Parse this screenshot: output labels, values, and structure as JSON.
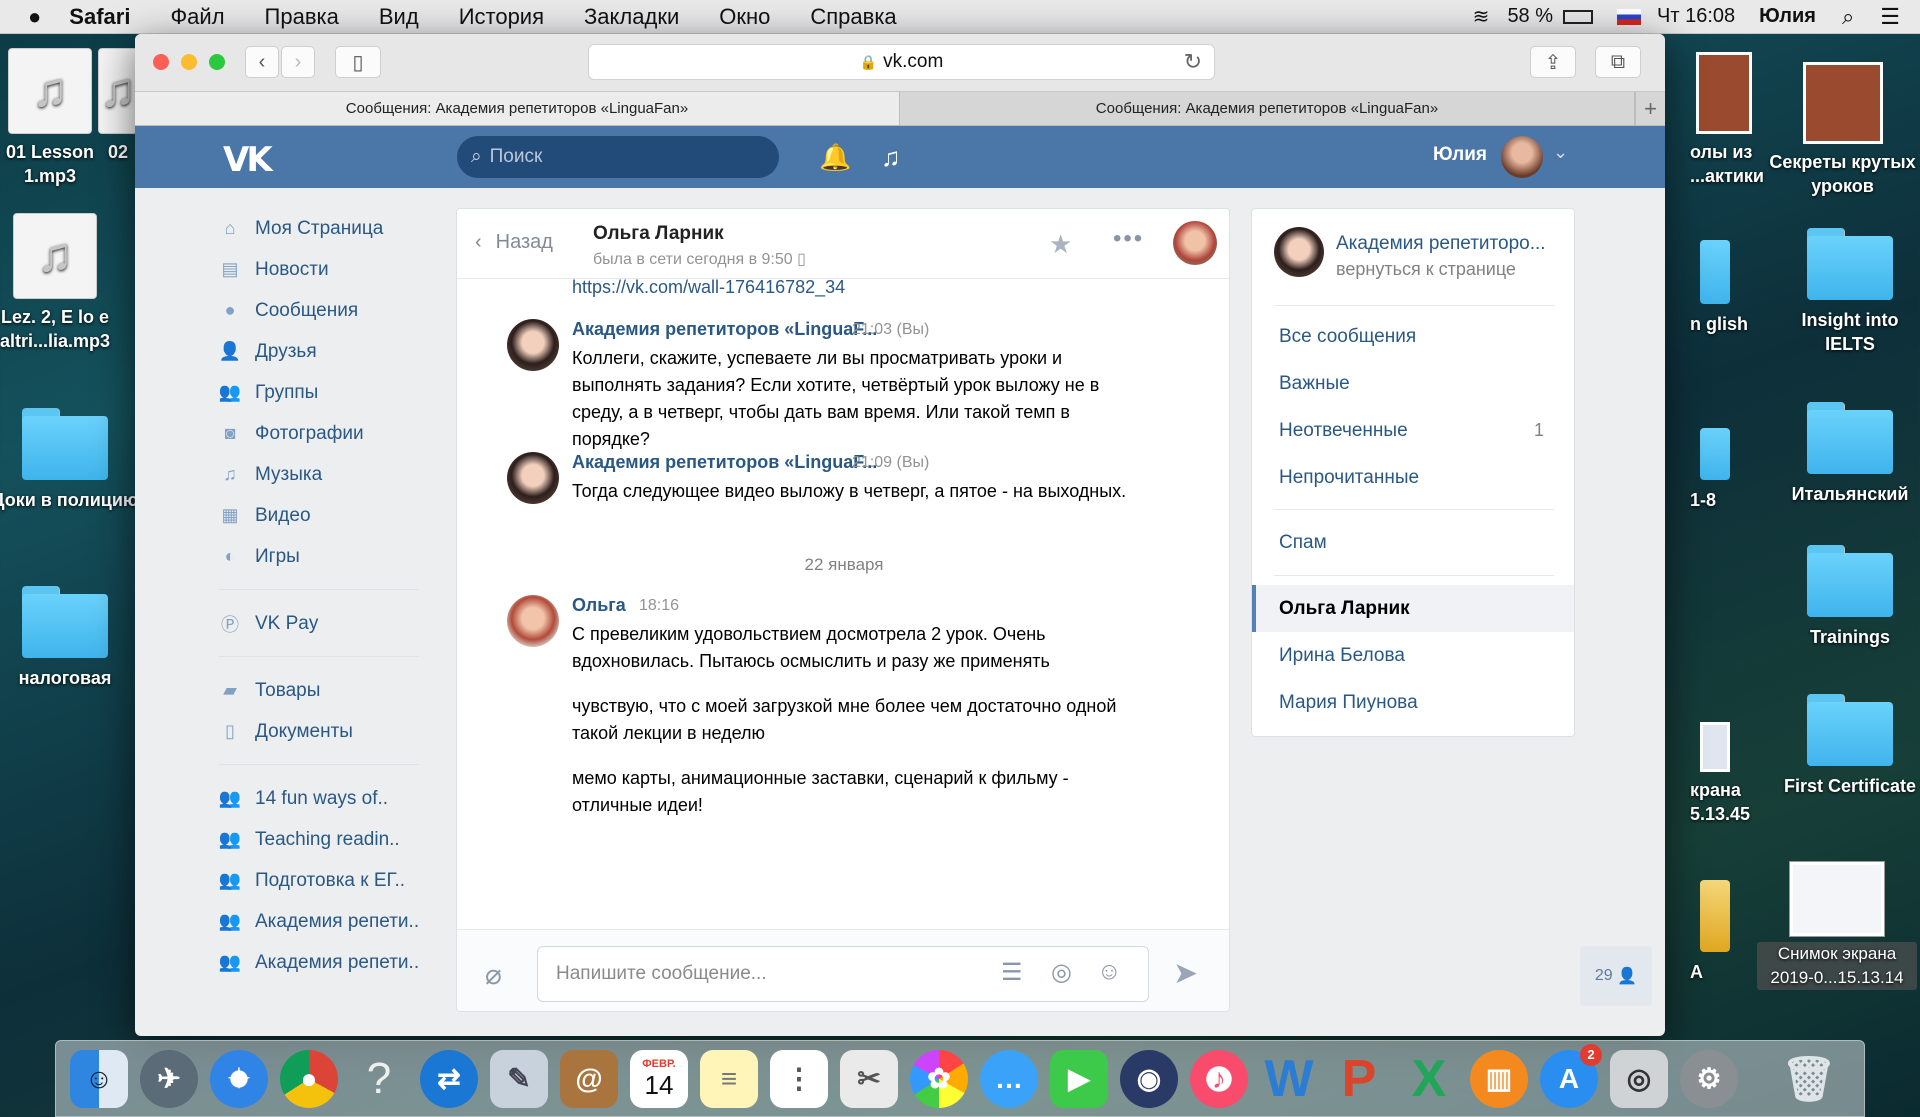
{
  "menubar": {
    "apple": "",
    "app": "Safari",
    "items": [
      "Файл",
      "Правка",
      "Вид",
      "История",
      "Закладки",
      "Окно",
      "Справка"
    ],
    "battery": "58 %",
    "clock": "Чт 16:08",
    "user": "Юлия"
  },
  "desktop": {
    "left": [
      {
        "label": "01 Lesson 1.mp3",
        "kind": "music"
      },
      {
        "label": "02",
        "kind": "music"
      },
      {
        "label": "Lez. 2, E lo e altri...lia.mp3",
        "kind": "music"
      },
      {
        "label": "Доки в полицию",
        "kind": "folder"
      },
      {
        "label": "налоговая",
        "kind": "folder"
      }
    ],
    "right": [
      {
        "label": "олы из ...актики",
        "kind": "thumb"
      },
      {
        "label": "Секреты крутых уроков",
        "kind": "thumb"
      },
      {
        "label": "n glish",
        "kind": "folder"
      },
      {
        "label": "Insight into IELTS",
        "kind": "folder"
      },
      {
        "label": "1-8",
        "kind": "folder"
      },
      {
        "label": "Итальянский",
        "kind": "folder"
      },
      {
        "label": "Trainings",
        "kind": "folder"
      },
      {
        "label": "крана 5.13.45",
        "kind": "thumb"
      },
      {
        "label": "First Certificate",
        "kind": "folder"
      },
      {
        "label": "A",
        "kind": "folder"
      },
      {
        "label": "Снимок экрана 2019-0...15.13.14",
        "kind": "thumb"
      }
    ]
  },
  "browser": {
    "url": "vk.com",
    "tabs": [
      "Сообщения: Академия репетиторов «LinguaFan»",
      "Сообщения: Академия репетиторов «LinguaFan»"
    ]
  },
  "vk": {
    "logo": "VK",
    "search_placeholder": "Поиск",
    "user_name": "Юлия",
    "nav": [
      {
        "label": "Моя Страница",
        "icon": "home-icon",
        "glyph": "⌂"
      },
      {
        "label": "Новости",
        "icon": "news-icon",
        "glyph": "▤"
      },
      {
        "label": "Сообщения",
        "icon": "messages-icon",
        "glyph": "●"
      },
      {
        "label": "Друзья",
        "icon": "friends-icon",
        "glyph": "👤"
      },
      {
        "label": "Группы",
        "icon": "groups-icon",
        "glyph": "👥"
      },
      {
        "label": "Фотографии",
        "icon": "photo-icon",
        "glyph": "◙"
      },
      {
        "label": "Музыка",
        "icon": "music-icon",
        "glyph": "♫"
      },
      {
        "label": "Видео",
        "icon": "video-icon",
        "glyph": "▦"
      },
      {
        "label": "Игры",
        "icon": "games-icon",
        "glyph": "◐"
      }
    ],
    "nav2": [
      {
        "label": "VK Pay",
        "icon": "vkpay-icon",
        "glyph": "Ⓟ"
      }
    ],
    "nav3": [
      {
        "label": "Товары",
        "icon": "goods-icon",
        "glyph": "▰"
      },
      {
        "label": "Документы",
        "icon": "documents-icon",
        "glyph": "▯"
      }
    ],
    "nav4": [
      {
        "label": "14 fun ways of..",
        "icon": "group-icon",
        "glyph": "👥"
      },
      {
        "label": "Teaching readin..",
        "icon": "group-icon",
        "glyph": "👥"
      },
      {
        "label": "Подготовка к ЕГ..",
        "icon": "group-icon",
        "glyph": "👥"
      },
      {
        "label": "Академия репети..",
        "icon": "group-icon",
        "glyph": "👥"
      },
      {
        "label": "Академия репети..",
        "icon": "group-icon",
        "glyph": "👥"
      }
    ]
  },
  "chat": {
    "back_label": "Назад",
    "name": "Ольга Ларник",
    "status": "была в сети сегодня в 9:50",
    "top_link": "https://vk.com/wall-176416782_34",
    "messages": [
      {
        "author": "Академия репетиторов «LinguaF...",
        "time": "21:03 (Вы)",
        "paragraphs": [
          "Коллеги, скажите, успеваете ли вы просматривать уроки и выполнять задания? Если хотите, четвёртый урок выложу не в среду, а в четверг, чтобы дать вам время. Или такой темп в порядке?"
        ]
      },
      {
        "author": "Академия репетиторов «LinguaF...",
        "time": "21:09 (Вы)",
        "paragraphs": [
          "Тогда следующее видео выложу в четверг, а пятое - на выходных."
        ]
      },
      {
        "author": "Ольга",
        "time": "18:16",
        "paragraphs": [
          "С превеликим удовольствием досмотрела 2 урок. Очень вдохновилась. Пытаюсь осмыслить и разу же применять",
          "чувствую, что с моей загрузкой мне более чем достаточно одной такой лекции в неделю",
          "мемо карты, анимационные заставки, сценарий к фильму - отличные идеи!"
        ]
      }
    ],
    "date_separator": "22 января",
    "input_placeholder": "Напишите сообщение..."
  },
  "right_panel": {
    "community": "Академия репетиторо...",
    "back_to_page": "вернуться к странице",
    "filters": [
      "Все сообщения",
      "Важные",
      "Неотвеченные",
      "Непрочитанные"
    ],
    "unanswered_count": "1",
    "spam": "Спам",
    "dialogs": [
      "Ольга Ларник",
      "Ирина Белова",
      "Мария Пиунова"
    ]
  },
  "people_count": "29",
  "dock": {
    "calendar_month": "ФЕВР.",
    "calendar_day": "14",
    "appstore_badge": "2"
  }
}
